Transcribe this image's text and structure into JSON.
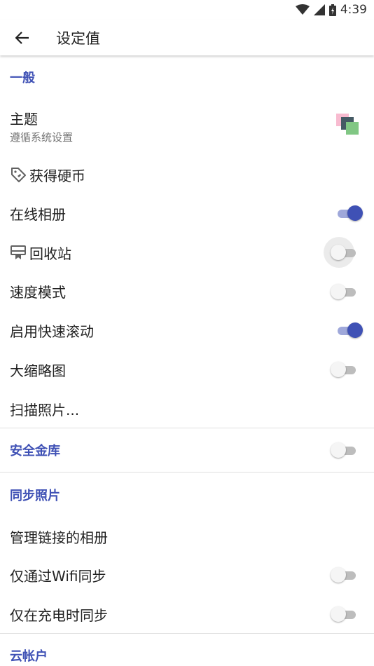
{
  "status": {
    "time": "4:39"
  },
  "appbar": {
    "title": "设定值"
  },
  "sections": {
    "general": "一般",
    "vault": "安全金库",
    "sync": "同步照片",
    "cloud": "云帐户"
  },
  "items": {
    "theme": {
      "label": "主题",
      "sub": "遵循系统设置"
    },
    "coins": {
      "label": "获得硬币"
    },
    "online_album": {
      "label": "在线相册",
      "on": true
    },
    "recycle": {
      "label": "回收站",
      "on": false
    },
    "speed_mode": {
      "label": "速度模式",
      "on": false
    },
    "fast_scroll": {
      "label": "启用快速滚动",
      "on": true
    },
    "big_thumbs": {
      "label": "大缩略图",
      "on": false
    },
    "scan_photos": {
      "label": "扫描照片..."
    },
    "vault_switch": {
      "on": false
    },
    "manage_albums": {
      "label": "管理链接的相册"
    },
    "wifi_only": {
      "label": "仅通过Wifi同步",
      "on": false
    },
    "charging_only": {
      "label": "仅在充电时同步",
      "on": false
    }
  },
  "colors": {
    "accent": "#3f51b5",
    "accent_track": "#9fa8da"
  }
}
